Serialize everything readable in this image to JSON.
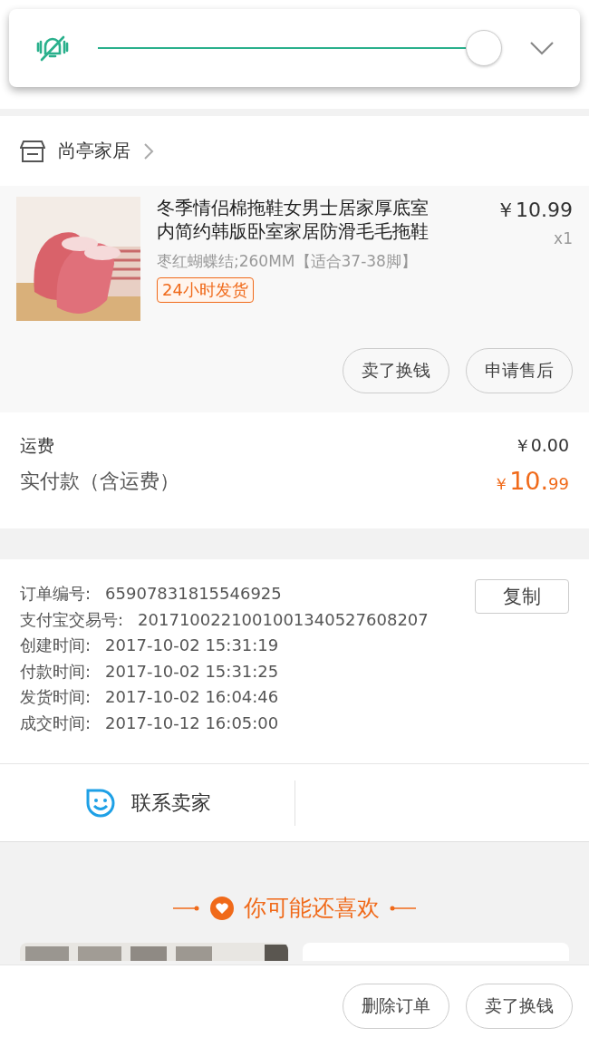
{
  "volume_panel": {
    "muted": true,
    "level": 1
  },
  "store": {
    "name": "尚亭家居"
  },
  "product": {
    "kind": "picture",
    "title": "冬季情侣棉拖鞋女男士居家厚底室内简约韩版卧室家居防滑毛毛拖鞋",
    "price": "￥10.99",
    "quantity": "x1",
    "spec": "枣红蝴蝶结;260MM【适合37-38脚】",
    "tag": "24小时发货",
    "actions": [
      "卖了换钱",
      "申请售后"
    ]
  },
  "costs": [
    {
      "label": "运费",
      "value": "￥0.00",
      "kind": "plain"
    },
    {
      "label": "实付款（含运费）",
      "currency": "￥",
      "value": "10.",
      "cents": "99",
      "kind": "total"
    }
  ],
  "order_info": {
    "copy_button": "复制",
    "rows": [
      {
        "label": "订单编号:",
        "value": "65907831815546925"
      },
      {
        "label": "支付宝交易号:",
        "value": "2017100221001001340527608207"
      },
      {
        "label": "创建时间:",
        "value": "2017-10-02 15:31:19"
      },
      {
        "label": "付款时间:",
        "value": "2017-10-02 15:31:25"
      },
      {
        "label": "发货时间:",
        "value": "2017-10-02 16:04:46"
      },
      {
        "label": "成交时间:",
        "value": "2017-10-12 16:05:00"
      }
    ]
  },
  "contact": {
    "label": "联系卖家"
  },
  "recommend": {
    "title": "你可能还喜欢"
  },
  "bottom_actions": [
    "删除订单",
    "卖了换钱"
  ]
}
